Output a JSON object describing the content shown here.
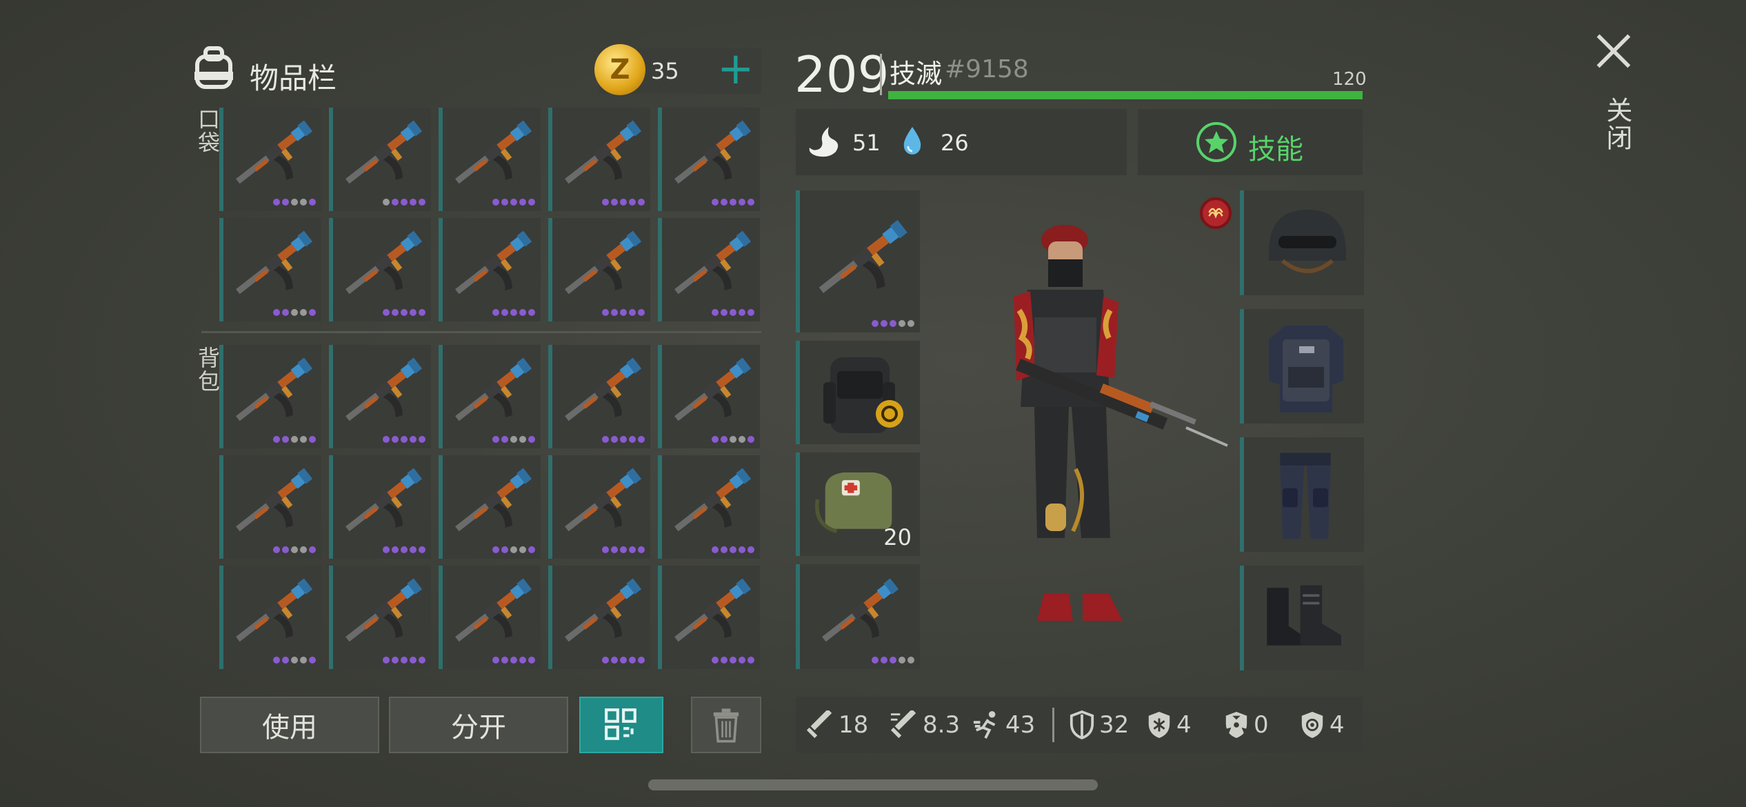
{
  "inventory": {
    "title": "物品栏",
    "coins": "35",
    "pocket_label": "口袋",
    "backpack_label": "背包",
    "pocket_items": [
      {
        "dots": [
          "p",
          "p",
          "g",
          "g",
          "p"
        ]
      },
      {
        "dots": [
          "g",
          "p",
          "p",
          "p",
          "p"
        ]
      },
      {
        "dots": [
          "p",
          "p",
          "p",
          "p",
          "p"
        ]
      },
      {
        "dots": [
          "p",
          "p",
          "p",
          "p",
          "p"
        ]
      },
      {
        "dots": [
          "p",
          "p",
          "p",
          "p",
          "p"
        ]
      },
      {
        "dots": [
          "p",
          "p",
          "g",
          "g",
          "p"
        ]
      },
      {
        "dots": [
          "p",
          "p",
          "p",
          "p",
          "p"
        ]
      },
      {
        "dots": [
          "p",
          "p",
          "p",
          "p",
          "p"
        ]
      },
      {
        "dots": [
          "p",
          "p",
          "p",
          "p",
          "p"
        ]
      },
      {
        "dots": [
          "p",
          "p",
          "p",
          "p",
          "p"
        ]
      }
    ],
    "backpack_items": [
      {
        "dots": [
          "p",
          "p",
          "g",
          "g",
          "p"
        ]
      },
      {
        "dots": [
          "p",
          "p",
          "p",
          "p",
          "p"
        ]
      },
      {
        "dots": [
          "p",
          "p",
          "g",
          "g",
          "p"
        ]
      },
      {
        "dots": [
          "p",
          "p",
          "p",
          "p",
          "p"
        ]
      },
      {
        "dots": [
          "p",
          "p",
          "g",
          "g",
          "p"
        ]
      },
      {
        "dots": [
          "p",
          "p",
          "g",
          "g",
          "p"
        ]
      },
      {
        "dots": [
          "p",
          "p",
          "p",
          "p",
          "p"
        ]
      },
      {
        "dots": [
          "p",
          "p",
          "g",
          "g",
          "p"
        ]
      },
      {
        "dots": [
          "p",
          "p",
          "p",
          "p",
          "p"
        ]
      },
      {
        "dots": [
          "p",
          "p",
          "p",
          "p",
          "p"
        ]
      },
      {
        "dots": [
          "p",
          "p",
          "g",
          "g",
          "p"
        ]
      },
      {
        "dots": [
          "p",
          "p",
          "p",
          "p",
          "p"
        ]
      },
      {
        "dots": [
          "p",
          "p",
          "p",
          "p",
          "p"
        ]
      },
      {
        "dots": [
          "p",
          "p",
          "p",
          "p",
          "p"
        ]
      },
      {
        "dots": [
          "p",
          "p",
          "p",
          "p",
          "p"
        ]
      }
    ],
    "use_button": "使用",
    "split_button": "分开"
  },
  "character": {
    "level": "209",
    "name": "技滅",
    "tag": "#9158",
    "hp": "120",
    "hp_fraction": 1.0,
    "food": "51",
    "water": "26",
    "skills_label": "技能",
    "medkit_count": "20"
  },
  "stats": {
    "melee_damage": "18",
    "melee_speed": "8.3",
    "move_speed": "43",
    "armor": "32",
    "cold_protection": "4",
    "radiation_protection": "0",
    "bio_protection": "4"
  },
  "close_label": "关闭",
  "colors": {
    "accent_teal": "#1f8c87",
    "hp_green": "#3fb33f",
    "rarity_purple": "#8a5bd0",
    "skill_green": "#58d36a"
  }
}
